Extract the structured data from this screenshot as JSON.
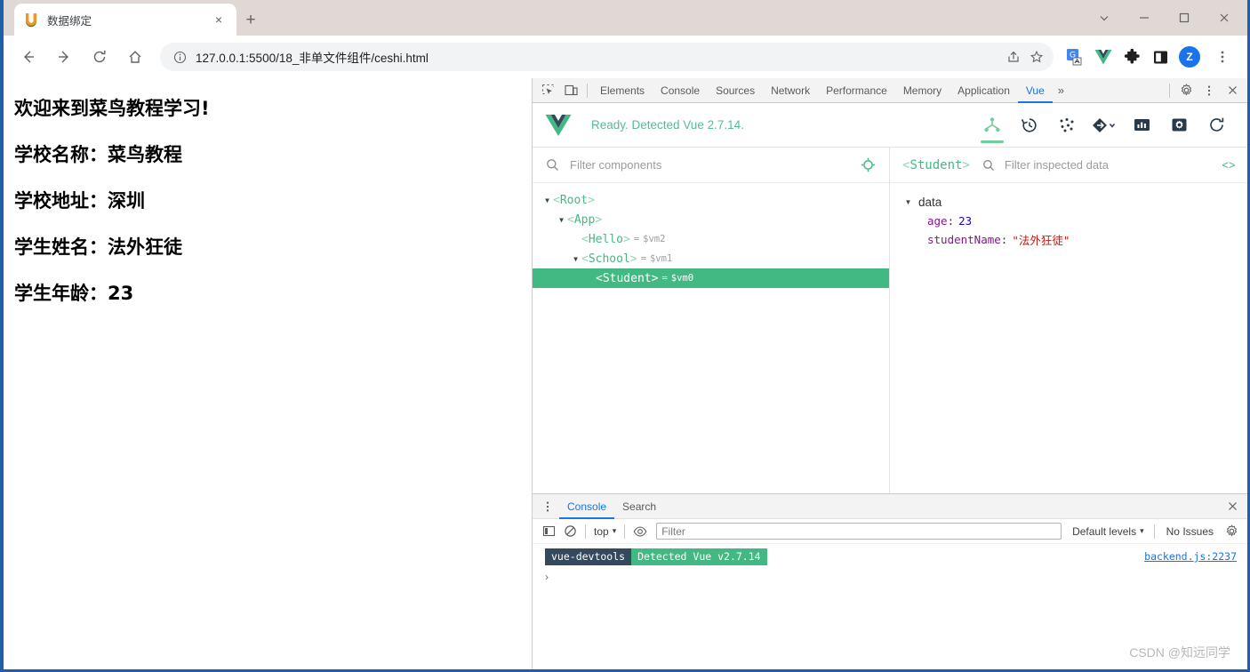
{
  "browser": {
    "tab": {
      "title": "数据绑定",
      "favicon": "runoob-logo-icon",
      "close": "×"
    },
    "new_tab_label": "+",
    "window_controls": [
      "chevron-down-icon",
      "minimize-icon",
      "maximize-icon",
      "close-icon"
    ],
    "nav": {
      "back": "back-icon",
      "forward": "forward-icon",
      "reload": "reload-icon",
      "home": "home-icon"
    },
    "omnibox": {
      "info_icon": "info-circle-icon",
      "url": "127.0.0.1:5500/18_非单文件组件/ceshi.html",
      "share_icon": "share-icon",
      "bookmark_icon": "star-icon"
    },
    "toolbar_icons": [
      "translate-icon",
      "vue-devtools-icon",
      "extensions-puzzle-icon",
      "sidepanel-icon"
    ],
    "profile_initial": "Z",
    "menu_icon": "three-dot-menu-icon"
  },
  "page": {
    "heading": "欢迎来到菜鸟教程学习!",
    "lines": [
      "学校名称：菜鸟教程",
      "学校地址：深圳",
      "学生姓名：法外狂徒",
      "学生年龄：23"
    ]
  },
  "devtools": {
    "left_icons": [
      "inspect-element-icon",
      "device-toolbar-icon"
    ],
    "tabs": [
      {
        "label": "Elements",
        "active": false
      },
      {
        "label": "Console",
        "active": false
      },
      {
        "label": "Sources",
        "active": false
      },
      {
        "label": "Network",
        "active": false
      },
      {
        "label": "Performance",
        "active": false
      },
      {
        "label": "Memory",
        "active": false
      },
      {
        "label": "Application",
        "active": false
      },
      {
        "label": "Vue",
        "active": true
      }
    ],
    "more_tabs": "»",
    "settings_icon": "gear-icon",
    "more_icon": "three-dot-menu-icon",
    "close_icon": "close-icon"
  },
  "vue_panel": {
    "logo": "vue-logo-icon",
    "status": "Ready. Detected Vue 2.7.14.",
    "status_color": "#5ab893",
    "accent_color": "#42b883",
    "tools": [
      {
        "name": "components-tree-icon",
        "active": true
      },
      {
        "name": "timeline-history-icon",
        "active": false
      },
      {
        "name": "events-icon",
        "active": false
      },
      {
        "name": "routing-icon",
        "active": false
      },
      {
        "name": "performance-chart-icon",
        "active": false
      },
      {
        "name": "settings-box-icon",
        "active": false
      },
      {
        "name": "refresh-icon",
        "active": false
      }
    ],
    "component_filter": {
      "placeholder": "Filter components",
      "value": ""
    },
    "select-target-icon": "target-crosshair-icon",
    "tree": [
      {
        "name": "Root",
        "vm": "",
        "depth": 0,
        "expandable": true,
        "expanded": true,
        "selected": false
      },
      {
        "name": "App",
        "vm": "",
        "depth": 1,
        "expandable": true,
        "expanded": true,
        "selected": false
      },
      {
        "name": "Hello",
        "vm": "$vm2",
        "depth": 2,
        "expandable": false,
        "expanded": false,
        "selected": false
      },
      {
        "name": "School",
        "vm": "$vm1",
        "depth": 2,
        "expandable": true,
        "expanded": true,
        "selected": false
      },
      {
        "name": "Student",
        "vm": "$vm0",
        "depth": 3,
        "expandable": false,
        "expanded": false,
        "selected": true
      }
    ],
    "inspector": {
      "component": "Student",
      "filter": {
        "placeholder": "Filter inspected data",
        "value": ""
      },
      "code_icon": "<>",
      "group_label": "data",
      "props": [
        {
          "key": "age",
          "value": "23",
          "type": "number"
        },
        {
          "key": "studentName",
          "value": "\"法外狂徒\"",
          "type": "string"
        }
      ]
    }
  },
  "console_drawer": {
    "menu_icon": "three-dot-menu-icon",
    "tabs": [
      {
        "label": "Console",
        "active": true
      },
      {
        "label": "Search",
        "active": false
      }
    ],
    "close_icon": "close-icon",
    "toolbar": {
      "sidebar_icon": "console-sidebar-icon",
      "clear_icon": "clear-console-icon",
      "context": "top",
      "context_caret": "▾",
      "eye_icon": "live-expression-eye-icon",
      "filter_placeholder": "Filter",
      "filter_value": "",
      "levels": "Default levels",
      "levels_caret": "▾",
      "issues": "No Issues",
      "settings_icon": "gear-icon"
    },
    "log": {
      "badge_source": "vue-devtools",
      "badge_message": "Detected Vue v2.7.14",
      "badge_source_color": "#35495e",
      "badge_message_color": "#42b883",
      "source_link": "backend.js:2237"
    },
    "prompt": "›"
  },
  "watermark": "CSDN @知远同学"
}
